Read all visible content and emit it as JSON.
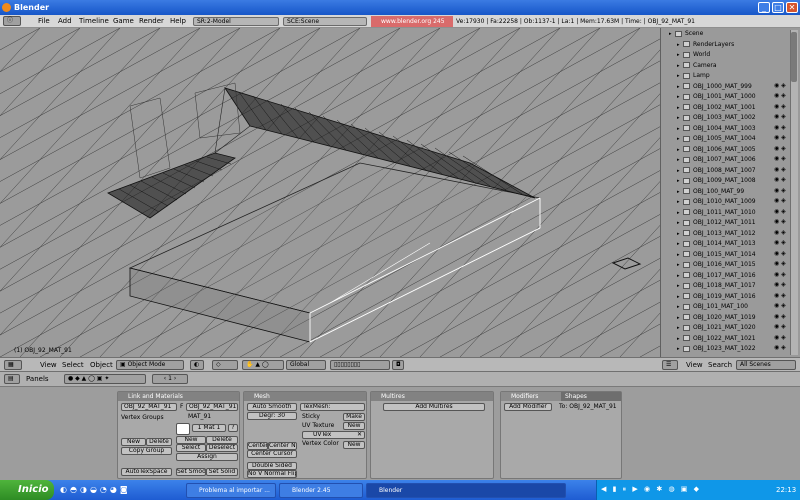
{
  "window": {
    "title": "Blender",
    "min": "_",
    "max": "□",
    "close": "✕"
  },
  "info_header": {
    "menus": [
      "File",
      "Add",
      "Timeline",
      "Game",
      "Render",
      "Help"
    ],
    "screen": "SR:2-Model",
    "scene": "SCE:Scene",
    "url": "www.blender.org 245",
    "stats": "Ve:17930 | Fa:22258 | Ob:1137-1 | La:1 | Mem:17.63M | Time: | OBJ_92_MAT_91"
  },
  "viewport": {
    "object_label": "(1) OBJ_92_MAT_91"
  },
  "outliner": {
    "items": [
      {
        "label": "Scene",
        "indent": 0
      },
      {
        "label": "RenderLayers",
        "indent": 1
      },
      {
        "label": "World",
        "indent": 1
      },
      {
        "label": "Camera",
        "indent": 1
      },
      {
        "label": "Lamp",
        "indent": 1
      },
      {
        "label": "OBJ_1000_MAT_999",
        "indent": 1
      },
      {
        "label": "OBJ_1001_MAT_1000",
        "indent": 1
      },
      {
        "label": "OBJ_1002_MAT_1001",
        "indent": 1
      },
      {
        "label": "OBJ_1003_MAT_1002",
        "indent": 1
      },
      {
        "label": "OBJ_1004_MAT_1003",
        "indent": 1
      },
      {
        "label": "OBJ_1005_MAT_1004",
        "indent": 1
      },
      {
        "label": "OBJ_1006_MAT_1005",
        "indent": 1
      },
      {
        "label": "OBJ_1007_MAT_1006",
        "indent": 1
      },
      {
        "label": "OBJ_1008_MAT_1007",
        "indent": 1
      },
      {
        "label": "OBJ_1009_MAT_1008",
        "indent": 1
      },
      {
        "label": "OBJ_100_MAT_99",
        "indent": 1
      },
      {
        "label": "OBJ_1010_MAT_1009",
        "indent": 1
      },
      {
        "label": "OBJ_1011_MAT_1010",
        "indent": 1
      },
      {
        "label": "OBJ_1012_MAT_1011",
        "indent": 1
      },
      {
        "label": "OBJ_1013_MAT_1012",
        "indent": 1
      },
      {
        "label": "OBJ_1014_MAT_1013",
        "indent": 1
      },
      {
        "label": "OBJ_1015_MAT_1014",
        "indent": 1
      },
      {
        "label": "OBJ_1016_MAT_1015",
        "indent": 1
      },
      {
        "label": "OBJ_1017_MAT_1016",
        "indent": 1
      },
      {
        "label": "OBJ_1018_MAT_1017",
        "indent": 1
      },
      {
        "label": "OBJ_1019_MAT_1016",
        "indent": 1
      },
      {
        "label": "OBJ_101_MAT_100",
        "indent": 1
      },
      {
        "label": "OBJ_1020_MAT_1019",
        "indent": 1
      },
      {
        "label": "OBJ_1021_MAT_1020",
        "indent": 1
      },
      {
        "label": "OBJ_1022_MAT_1021",
        "indent": 1
      },
      {
        "label": "OBJ_1023_MAT_1022",
        "indent": 1
      }
    ]
  },
  "view3d_header": {
    "menus": [
      "View",
      "Select",
      "Object"
    ],
    "mode": "Object Mode",
    "orientation": "Global"
  },
  "outliner_header": {
    "menus": [
      "View",
      "Search"
    ],
    "filter": "All Scenes"
  },
  "buttons_header": {
    "panels_label": "Panels",
    "frame": "1"
  },
  "panels": {
    "link": {
      "title": "Link and Materials",
      "ob_field": "OBJ_92_MAT_91",
      "f_label": "F",
      "me_field": "OBJ_92_MAT_91",
      "mat_name": "MAT_91",
      "vertex_groups": "Vertex Groups",
      "mat_index": "1 Mat 1",
      "question": "?",
      "new_left": "New",
      "delete_left": "Delete",
      "copy_group": "Copy Group",
      "new_right": "New",
      "delete_right": "Delete",
      "select": "Select",
      "deselect": "Deselect",
      "assign": "Assign",
      "autotexspace": "AutoTexSpace",
      "set_smooth": "Set Smoot",
      "set_solid": "Set Solid"
    },
    "mesh": {
      "title": "Mesh",
      "auto_smooth": "Auto Smooth",
      "degr": "Degr: 30",
      "texmesh": "TexMesh:",
      "sticky": "Sticky",
      "make": "Make",
      "uv_texture": "UV Texture",
      "new_uv": "New",
      "uvtex": "UVTex",
      "vertex_color": "Vertex Color",
      "new_vc": "New",
      "center": "Center",
      "center_new": "Center Ne",
      "center_cursor": "Center Cursor",
      "double_sided": "Double Sided",
      "no_v_normal": "No V Normal Flip"
    },
    "multires": {
      "title": "Multires",
      "add": "Add Multires"
    },
    "modifiers": {
      "tab_modifiers": "Modifiers",
      "tab_shapes": "Shapes",
      "add_modifier": "Add Modifier",
      "to_label": "To: OBJ_92_MAT_91"
    }
  },
  "taskbar": {
    "start": "Inicio",
    "tasks": [
      "Problema al importar ...",
      "Blender 2.45",
      "Blender"
    ],
    "clock": "22:13"
  },
  "colors": {
    "titlebar": "#1f5fd0",
    "url_bg": "#d96b6b",
    "start": "#3a9c2e"
  }
}
